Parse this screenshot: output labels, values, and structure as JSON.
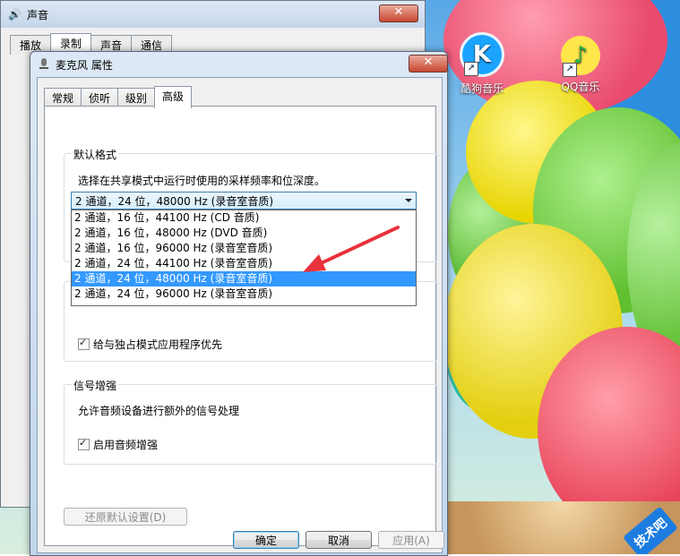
{
  "desktop": {
    "icons": [
      {
        "label": "酷狗音乐",
        "glyph": "K",
        "icon": "kugou-music-icon"
      },
      {
        "label": "QQ音乐",
        "glyph": "♪",
        "icon": "qq-music-icon"
      }
    ],
    "watermark": "技术吧"
  },
  "back_window": {
    "title": "声音",
    "close": "✕",
    "tabs": [
      "播放",
      "录制",
      "声音",
      "通信"
    ],
    "active_tab": "录制"
  },
  "dialog": {
    "title": "麦克风 属性",
    "close": "✕",
    "tabs": [
      "常规",
      "侦听",
      "级别",
      "高级"
    ],
    "active_tab": "高级",
    "default_format": {
      "label": "默认格式",
      "description": "选择在共享模式中运行时使用的采样频率和位深度。",
      "selected": "2 通道，24 位，48000 Hz (录音室音质)",
      "options": [
        "2 通道，16 位，44100 Hz (CD 音质)",
        "2 通道，16 位，48000 Hz (DVD 音质)",
        "2 通道，16 位，96000 Hz (录音室音质)",
        "2 通道，24 位，44100 Hz (录音室音质)",
        "2 通道，24 位，48000 Hz (录音室音质)",
        "2 通道，24 位，96000 Hz (录音室音质)"
      ],
      "highlighted_index": 4
    },
    "exclusive": {
      "label_partial": "独",
      "priority_checkbox": "给与独占模式应用程序优先",
      "priority_checked": true
    },
    "signal_enhance": {
      "label": "信号增强",
      "description": "允许音频设备进行额外的信号处理",
      "checkbox": "启用音频增强",
      "checked": true
    },
    "restore_defaults": "还原默认设置(D)",
    "ok": "确定",
    "cancel": "取消",
    "apply": "应用(A)"
  },
  "colors": {
    "highlight": "#3399ff",
    "arrow": "#e8313a"
  }
}
